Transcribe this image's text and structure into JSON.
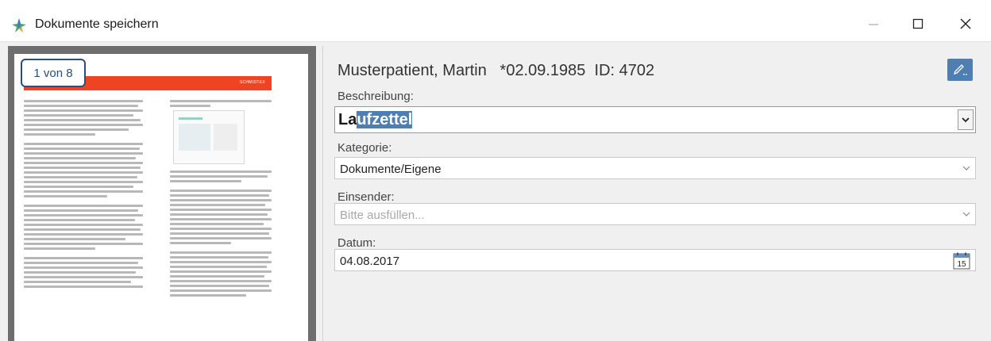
{
  "window": {
    "title": "Dokumente speichern",
    "controls": {
      "minimize": "—",
      "maximize": "☐",
      "close": "✕"
    },
    "icon": "app-star-icon"
  },
  "preview": {
    "page_indicator": "1 von 8",
    "banner_text": "SCHMIDTEX"
  },
  "form": {
    "patient": {
      "name": "Musterpatient, Martin",
      "birth": "*02.09.1985",
      "id_label": "ID: 4702"
    },
    "edit_button_icon": "pencil-icon",
    "beschreibung": {
      "label": "Beschreibung:",
      "value_prefix": "La",
      "value_selected": "ufzettel"
    },
    "kategorie": {
      "label": "Kategorie:",
      "value": "Dokumente/Eigene"
    },
    "einsender": {
      "label": "Einsender:",
      "placeholder": "Bitte ausfüllen..."
    },
    "datum": {
      "label": "Datum:",
      "value": "04.08.2017",
      "calendar_day": "15"
    }
  },
  "colors": {
    "accent": "#4e7fb0",
    "banner": "#ee4422",
    "badge_border": "#2a4f7a"
  }
}
